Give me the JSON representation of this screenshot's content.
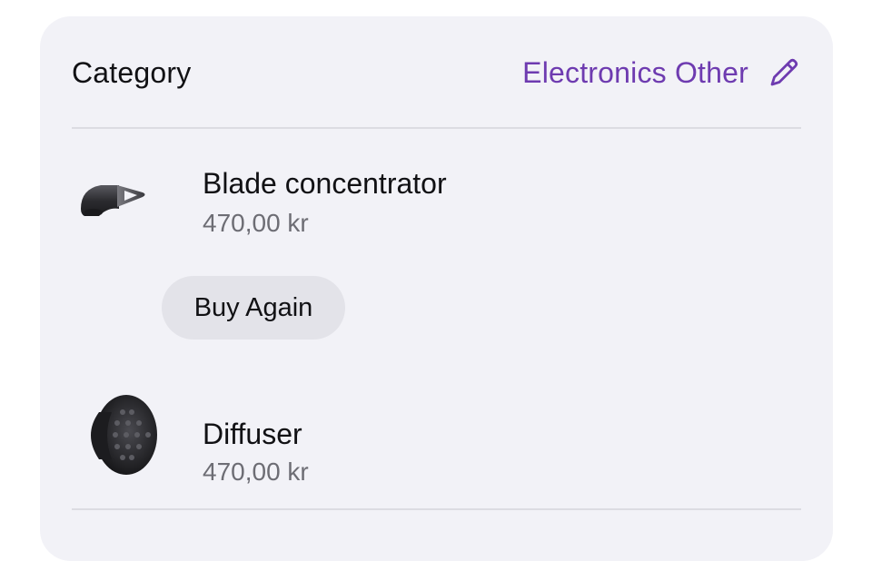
{
  "category": {
    "label": "Category",
    "value": "Electronics Other",
    "edit_icon": "pencil-icon",
    "accent_color": "#6e3bb0"
  },
  "items": [
    {
      "name": "Blade concentrator",
      "price": "470,00 kr",
      "image_icon": "blade-concentrator-image",
      "action_label": "Buy Again"
    },
    {
      "name": "Diffuser",
      "price": "470,00 kr",
      "image_icon": "diffuser-image"
    }
  ]
}
